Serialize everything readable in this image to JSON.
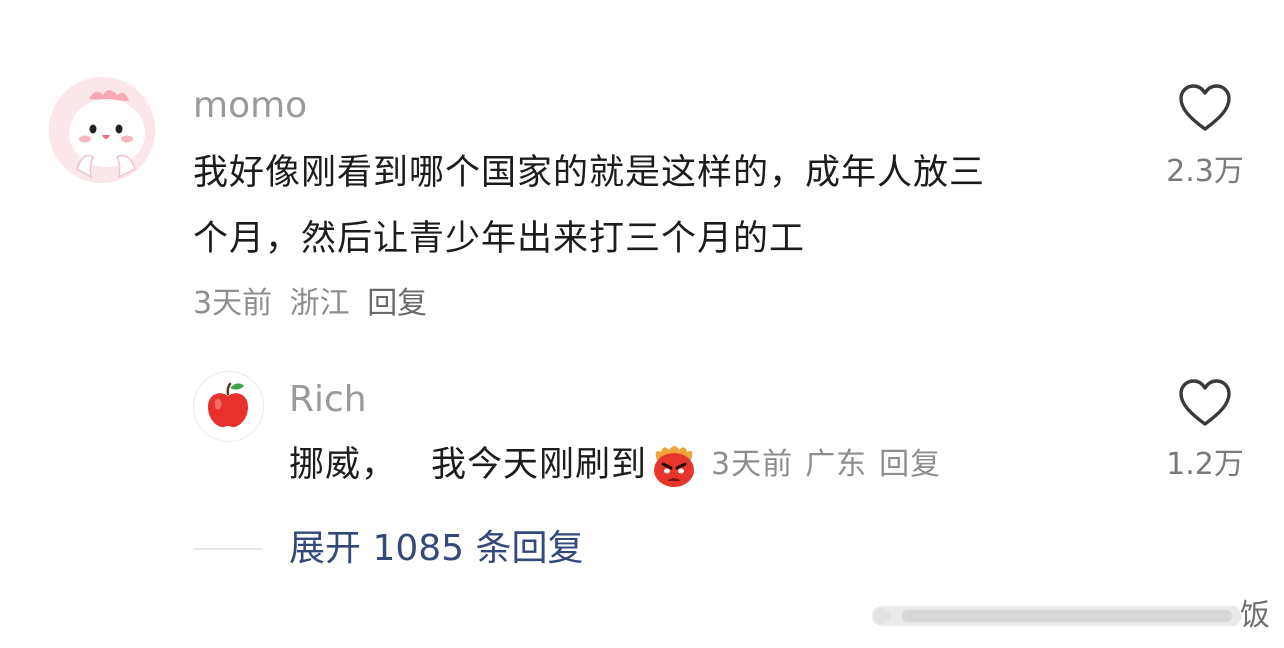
{
  "comment": {
    "username": "momo",
    "text_line1": "我好像刚看到哪个国家的就是这样的，成年人放三",
    "text_line2": "个月，然后让青少年出来打三个月的工",
    "time": "3天前",
    "location": "浙江",
    "reply_label": "回复",
    "like_count": "2.3万",
    "avatar_icon": "cartoon-dino-avatar"
  },
  "reply": {
    "username": "Rich",
    "text_part1": "挪威，",
    "text_part2": "我今天刚刷到",
    "emoji": "angry-face-emoji",
    "time": "3天前",
    "location": "广东",
    "reply_label": "回复",
    "like_count": "1.2万",
    "avatar_icon": "apple-avatar"
  },
  "expand": {
    "label": "展开 1085 条回复"
  },
  "watermark": {
    "text": "饭"
  },
  "colors": {
    "username": "#9a9a9a",
    "meta": "#8e8e8e",
    "expand_link": "#34497a",
    "heart_outline": "#3a3a3a"
  }
}
